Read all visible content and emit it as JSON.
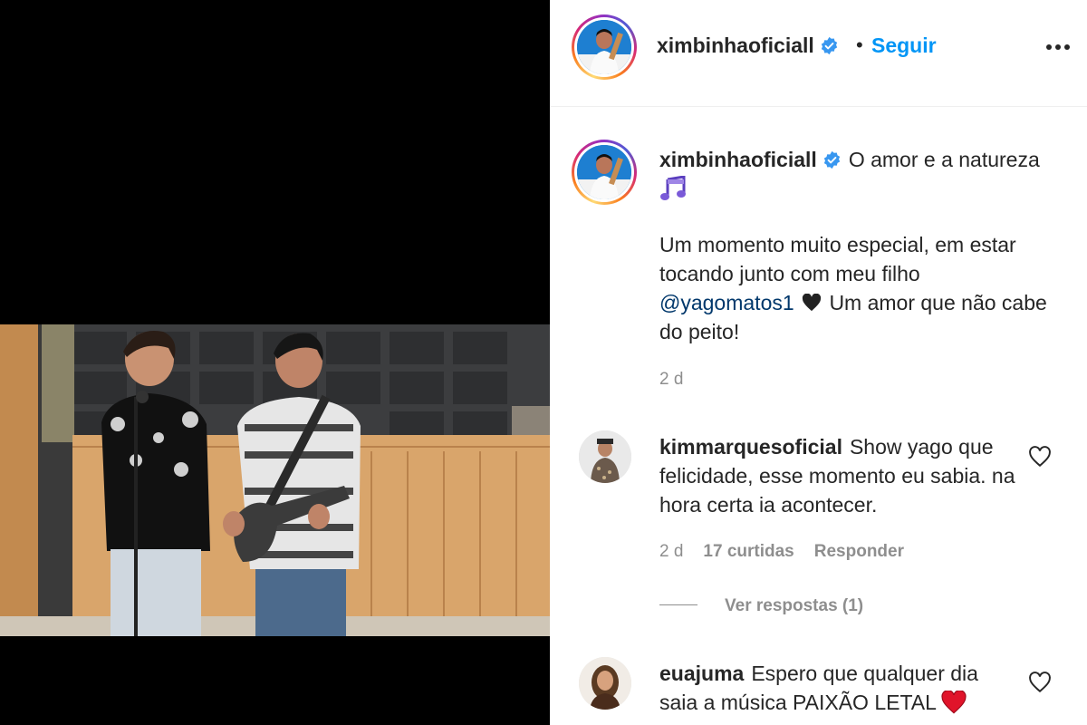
{
  "post": {
    "author": "ximbinhaoficiall",
    "separator": "•",
    "follow_label": "Seguir",
    "caption_line1": "O amor e a natureza",
    "caption_line2": "Um momento muito especial, em estar tocando junto com meu filho",
    "caption_mention": "@yagomatos1",
    "caption_line3": "Um amor que não cabe do peito!",
    "time": "2 d"
  },
  "comments": [
    {
      "username": "kimmarquesoficial",
      "text": "Show yago que felicidade, esse momento eu sabia. na hora certa ia acontecer.",
      "time": "2 d",
      "likes": "17 curtidas",
      "reply_label": "Responder",
      "view_replies": "Ver respostas (1)"
    },
    {
      "username": "euajuma",
      "text": "Espero que qualquer dia saia a música PAIXÃO LETAL"
    }
  ],
  "icons": {
    "verified": "verified-badge-icon",
    "more": "more-options-icon",
    "like": "heart-outline-icon",
    "music": "musical-notes-emoji",
    "black_heart": "black-heart-emoji",
    "red_heart": "red-heart-emoji"
  },
  "colors": {
    "link_blue": "#0095f6",
    "mention_blue": "#00376b",
    "verified_blue": "#3897f0",
    "muted_gray": "#8e8e8e",
    "text_dark": "#262626"
  }
}
